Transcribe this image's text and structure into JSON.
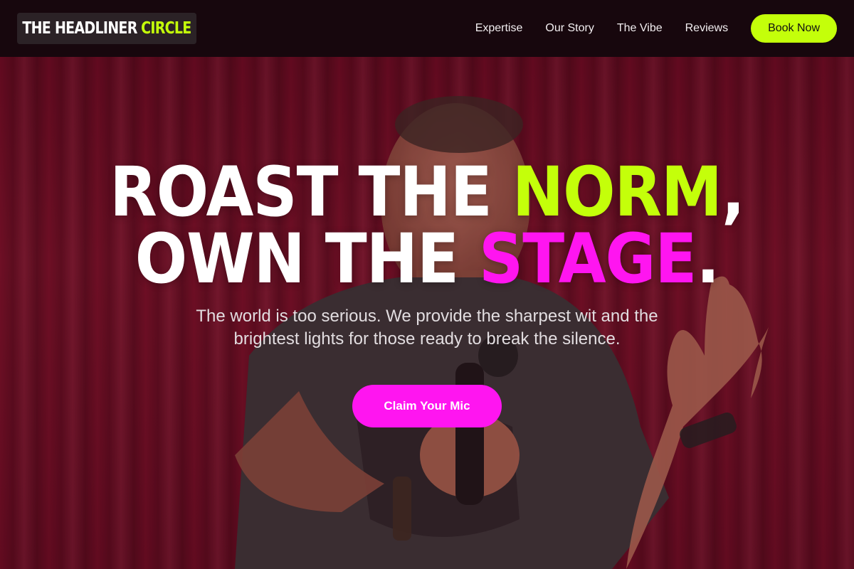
{
  "nav": {
    "logo_white": "THE HEADLINER",
    "logo_accent": "CIRCLE",
    "links": [
      "Expertise",
      "Our Story",
      "The Vibe",
      "Reviews"
    ],
    "cta_label": "Book Now"
  },
  "hero": {
    "line1_a": "ROAST THE ",
    "line1_accent": "NORM",
    "line1_end": ",",
    "line2_a": "OWN THE ",
    "line2_accent": "STAGE",
    "line2_end": ".",
    "subtitle": "The world is too serious. We provide the sharpest wit and the brightest lights for those ready to break the silence.",
    "cta_label": "Claim Your Mic"
  },
  "colors": {
    "accent_lime": "#c4ff0a",
    "accent_pink": "#ff15f0",
    "nav_bg": "#17070d",
    "curtain": "#7a1229"
  }
}
